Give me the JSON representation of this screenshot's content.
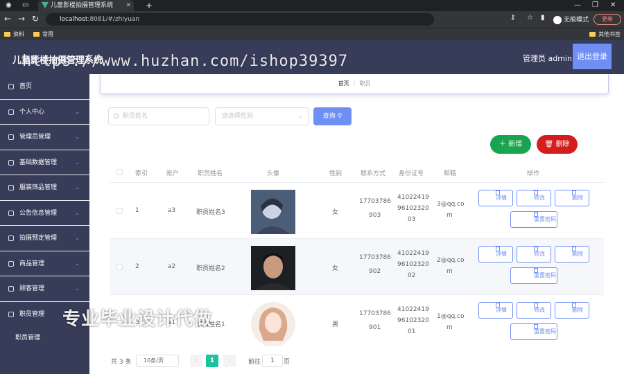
{
  "browser": {
    "tab_title": "儿童影楼拍摄管理系统",
    "url_host": "localhost",
    "url_rest": ":8081/#/zhiyuan",
    "incognito_label": "无痕模式",
    "update_label": "更新",
    "bookmarks": [
      "资料",
      "常用"
    ],
    "other_bookmarks": "其他书签"
  },
  "header": {
    "title": "儿童影楼拍摄管理系统",
    "user_label": "管理员 admin",
    "logout_label": "退出登录"
  },
  "sidebar": {
    "items": [
      {
        "label": "首页",
        "icon": "home-icon"
      },
      {
        "label": "个人中心",
        "icon": "user-icon"
      },
      {
        "label": "管理员管理",
        "icon": "monitor-icon"
      },
      {
        "label": "基础数据管理",
        "icon": "bell-icon"
      },
      {
        "label": "服装饰品管理",
        "icon": "grid-icon"
      },
      {
        "label": "公告信息管理",
        "icon": "settings-icon"
      },
      {
        "label": "拍摄预定管理",
        "icon": "power-icon"
      },
      {
        "label": "商品管理",
        "icon": "globe-icon"
      },
      {
        "label": "顾客管理",
        "icon": "person-icon"
      },
      {
        "label": "职员管理",
        "icon": "mail-icon"
      }
    ],
    "sub_item": "职员管理"
  },
  "breadcrumb": {
    "home": "首页",
    "current": "职员"
  },
  "search": {
    "name_placeholder": "职员姓名",
    "gender_placeholder": "请选择性别",
    "query_label": "查询"
  },
  "actions": {
    "add_label": "新增",
    "delete_label": "删除"
  },
  "table": {
    "headers": [
      "索引",
      "账户",
      "职员姓名",
      "头像",
      "性别",
      "联系方式",
      "身份证号",
      "邮箱",
      "操作"
    ],
    "rows": [
      {
        "index": "1",
        "account": "a3",
        "name": "职员姓名3",
        "gender": "女",
        "phone": [
          "17703786",
          "903"
        ],
        "idcard": [
          "41022419",
          "96102320",
          "03"
        ],
        "email": [
          "3@qq.co",
          "m"
        ]
      },
      {
        "index": "2",
        "account": "a2",
        "name": "职员姓名2",
        "gender": "女",
        "phone": [
          "17703786",
          "902"
        ],
        "idcard": [
          "41022419",
          "96102320",
          "02"
        ],
        "email": [
          "2@qq.co",
          "m"
        ]
      },
      {
        "index": "3",
        "account": "a1",
        "name": "职员姓名1",
        "gender": "男",
        "phone": [
          "17703786",
          "901"
        ],
        "idcard": [
          "41022419",
          "96102320",
          "01"
        ],
        "email": [
          "1@qq.co",
          "m"
        ]
      }
    ],
    "op_labels": {
      "detail": "详情",
      "edit": "修改",
      "delete": "删除",
      "reset": "重置密码"
    }
  },
  "pagination": {
    "total": "共 3 条",
    "page_size": "10条/页",
    "current_page": "1",
    "goto_label": "前往",
    "goto_value": "1",
    "page_suffix": "页"
  },
  "watermarks": {
    "url": "https://www.huzhan.com/ishop39397",
    "text": "专业毕业设计代做"
  },
  "colors": {
    "primary": "#6f8ff5",
    "sidebar": "#373c59",
    "success": "#19a550",
    "danger": "#d41e1e",
    "page_active": "#19c59f"
  }
}
